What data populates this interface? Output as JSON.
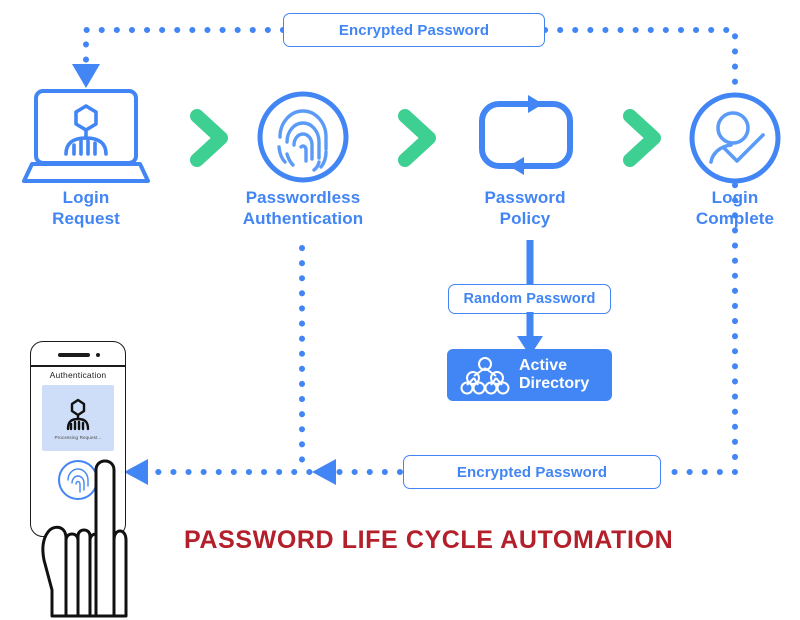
{
  "diagram": {
    "title": "PASSWORD LIFE CYCLE AUTOMATION",
    "title_color": "#B3202C",
    "accent_blue": "#4285F4",
    "accent_green": "#3ECF92",
    "background": "#FFFFFF"
  },
  "stages": [
    {
      "id": "login-request",
      "label": "Login\nRequest",
      "icon": "laptop-user-icon"
    },
    {
      "id": "passwordless-authentication",
      "label": "Passwordless\nAuthentication",
      "icon": "fingerprint-icon"
    },
    {
      "id": "password-policy",
      "label": "Password\nPolicy",
      "icon": "refresh-cycle-icon"
    },
    {
      "id": "login-complete",
      "label": "Login\nComplete",
      "icon": "user-check-icon"
    }
  ],
  "connectors": [
    {
      "id": "chevron-1",
      "icon": "chevron-right-icon",
      "color": "#3ECF92"
    },
    {
      "id": "chevron-2",
      "icon": "chevron-right-icon",
      "color": "#3ECF92"
    },
    {
      "id": "chevron-3",
      "icon": "chevron-right-icon",
      "color": "#3ECF92"
    }
  ],
  "boxes": {
    "encrypted_password_top": {
      "label": "Encrypted Password"
    },
    "encrypted_password_bottom": {
      "label": "Encrypted Password"
    },
    "random_password": {
      "label": "Random Password"
    },
    "active_directory": {
      "label": "Active\nDirectory",
      "icon": "directory-tree-icon",
      "fill": "#4285F4"
    }
  },
  "phone": {
    "screen_heading": "Authentication",
    "card_caption": "Processing Request...",
    "card_icon": "user-icon",
    "button_icon": "fingerprint-button-icon",
    "hand_icon": "hand-tap-icon"
  }
}
